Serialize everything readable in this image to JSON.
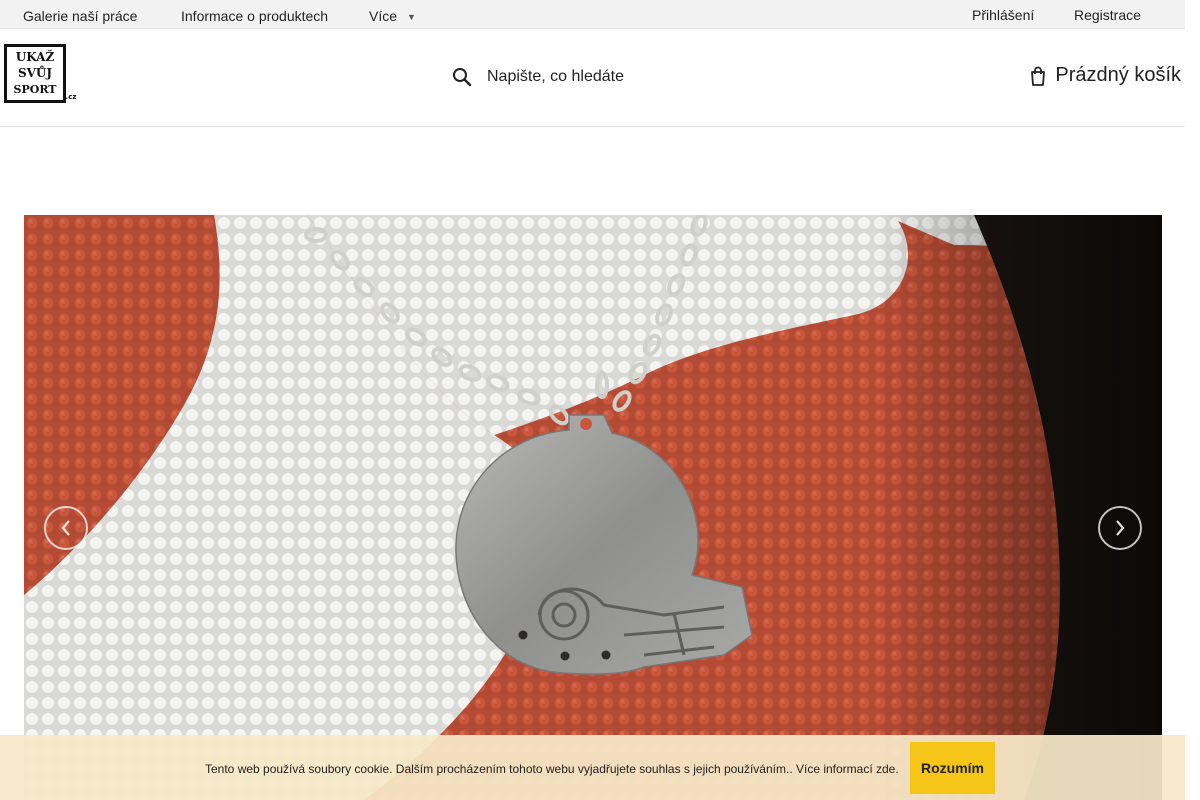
{
  "topbar": {
    "links": [
      "Galerie naší práce",
      "Informace o produktech",
      "Více"
    ],
    "more_icon": "chevron-down-icon",
    "login": "Přihlášení",
    "register": "Registrace"
  },
  "header": {
    "logo_text": [
      "UKAŽ",
      "SVŮJ",
      "SPORT",
      ".cz"
    ],
    "search_placeholder": "Napište, co hledáte",
    "search_icon": "search-icon",
    "cart_label": "Prázdný košík",
    "cart_icon": "cart-icon"
  },
  "hero": {
    "image": "football-helmet-pendant-on-american-football",
    "prev_icon": "chevron-left-icon",
    "next_icon": "chevron-right-icon"
  },
  "cookie": {
    "text": "Tento web používá soubory cookie. Dalším procházením tohoto webu vyjadřujete souhlas s jejich používáním.. Více informací zde.",
    "accept": "Rozumím"
  },
  "colors": {
    "accent": "#f5c518",
    "topbar_bg": "#f2f2f2",
    "cookie_bg": "#f6e8c8",
    "ball_red": "#b34a34"
  }
}
